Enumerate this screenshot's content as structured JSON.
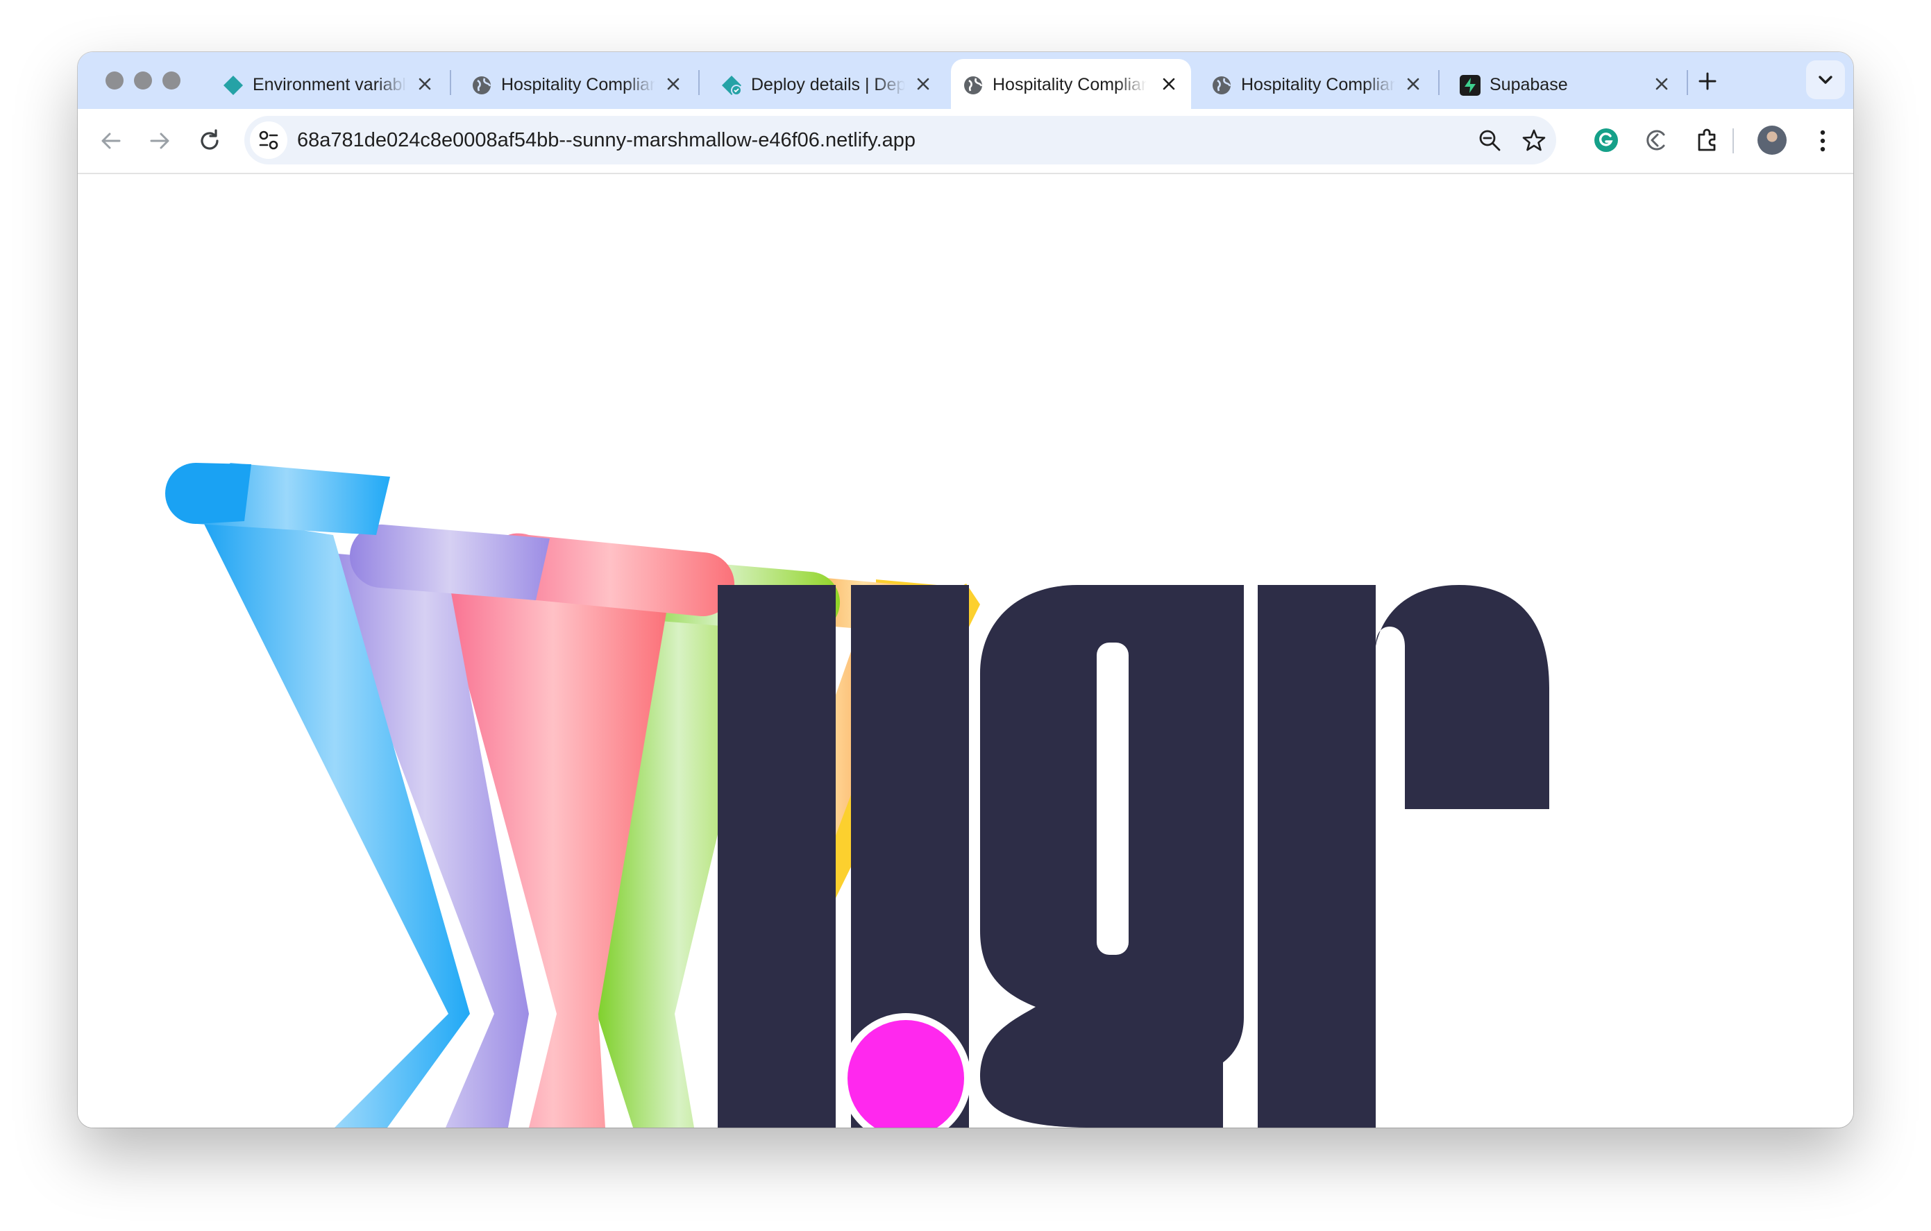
{
  "browser": {
    "tabs": [
      {
        "title": "Environment variables",
        "favicon": "netlify-diamond-icon",
        "active": false
      },
      {
        "title": "Hospitality Compliance",
        "favicon": "globe-icon",
        "active": false
      },
      {
        "title": "Deploy details | Deploys",
        "favicon": "netlify-deploy-icon",
        "active": false
      },
      {
        "title": "Hospitality Compliance",
        "favicon": "globe-icon",
        "active": true
      },
      {
        "title": "Hospitality Compliance",
        "favicon": "globe-icon",
        "active": false
      },
      {
        "title": "Supabase",
        "favicon": "supabase-icon",
        "active": false
      }
    ],
    "url": "68a781de024c8e0008af54bb--sunny-marshmallow-e46f06.netlify.app"
  },
  "page": {
    "logo_colors": {
      "blue": "#22a9f5",
      "purple": "#9a8ce6",
      "pink": "#fa6f92",
      "green": "#8fd42b",
      "orange": "#f8882a",
      "yellow": "#fcd02e",
      "letters": "#2d2d47",
      "dot": "#ff28ee"
    }
  }
}
